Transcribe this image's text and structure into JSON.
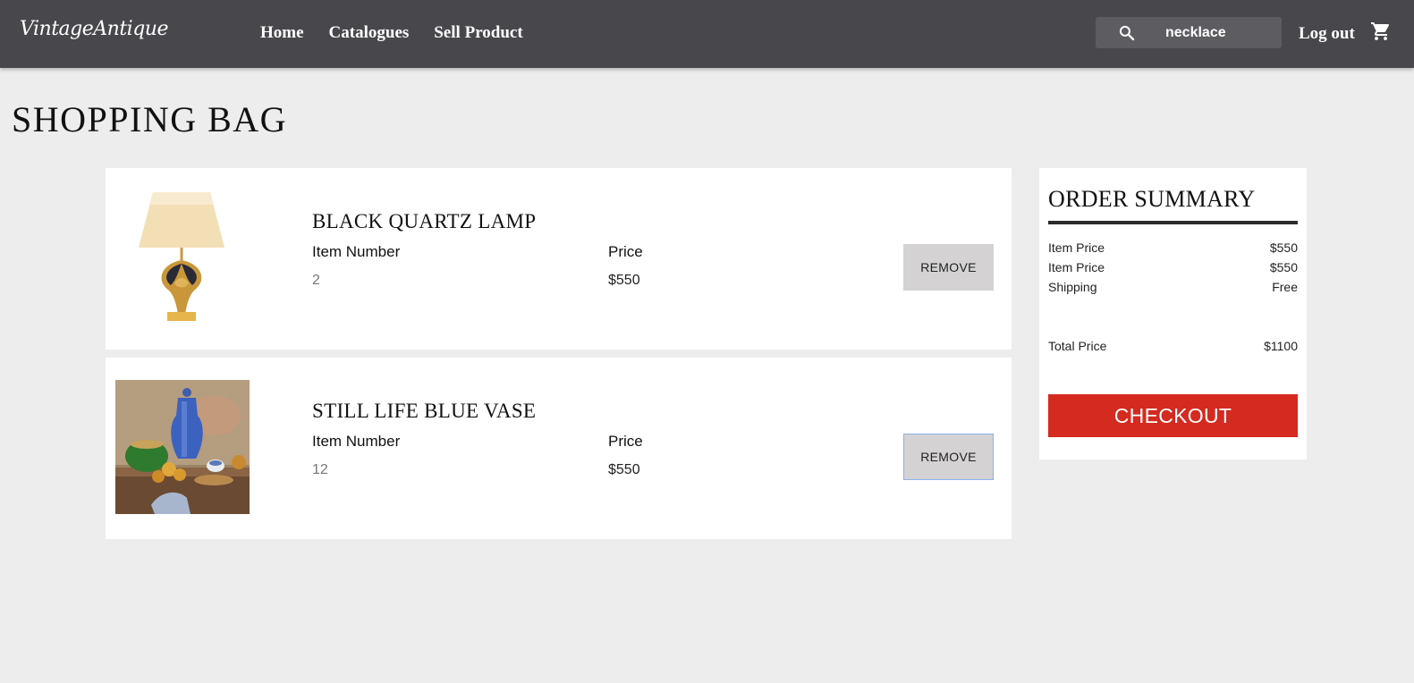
{
  "header": {
    "logo": "VintageAntique",
    "nav": [
      "Home",
      "Catalogues",
      "Sell Product"
    ],
    "search": {
      "value": "necklace",
      "icon": "search-icon"
    },
    "logout_label": "Log out",
    "cart_icon": "cart-icon"
  },
  "page": {
    "title": "SHOPPING BAG"
  },
  "products": [
    {
      "name": "BLACK QUARTZ LAMP",
      "item_number_label": "Item Number",
      "item_number": "2",
      "price_label": "Price",
      "price": "$550",
      "remove_label": "REMOVE"
    },
    {
      "name": "STILL LIFE BLUE VASE",
      "item_number_label": "Item Number",
      "item_number": "12",
      "price_label": "Price",
      "price": "$550",
      "remove_label": "REMOVE"
    }
  ],
  "summary": {
    "title": "ORDER SUMMARY",
    "rows": [
      {
        "label": "Item Price",
        "value": "$550"
      },
      {
        "label": "Item Price",
        "value": "$550"
      },
      {
        "label": "Shipping",
        "value": "Free"
      }
    ],
    "total_label": "Total Price",
    "total_value": "$1100",
    "checkout_label": "CHECKOUT"
  },
  "colors": {
    "topbar": "#48474c",
    "page_bg": "#ededed",
    "checkout": "#d42a1f",
    "remove_button": "#d4d2d3"
  }
}
